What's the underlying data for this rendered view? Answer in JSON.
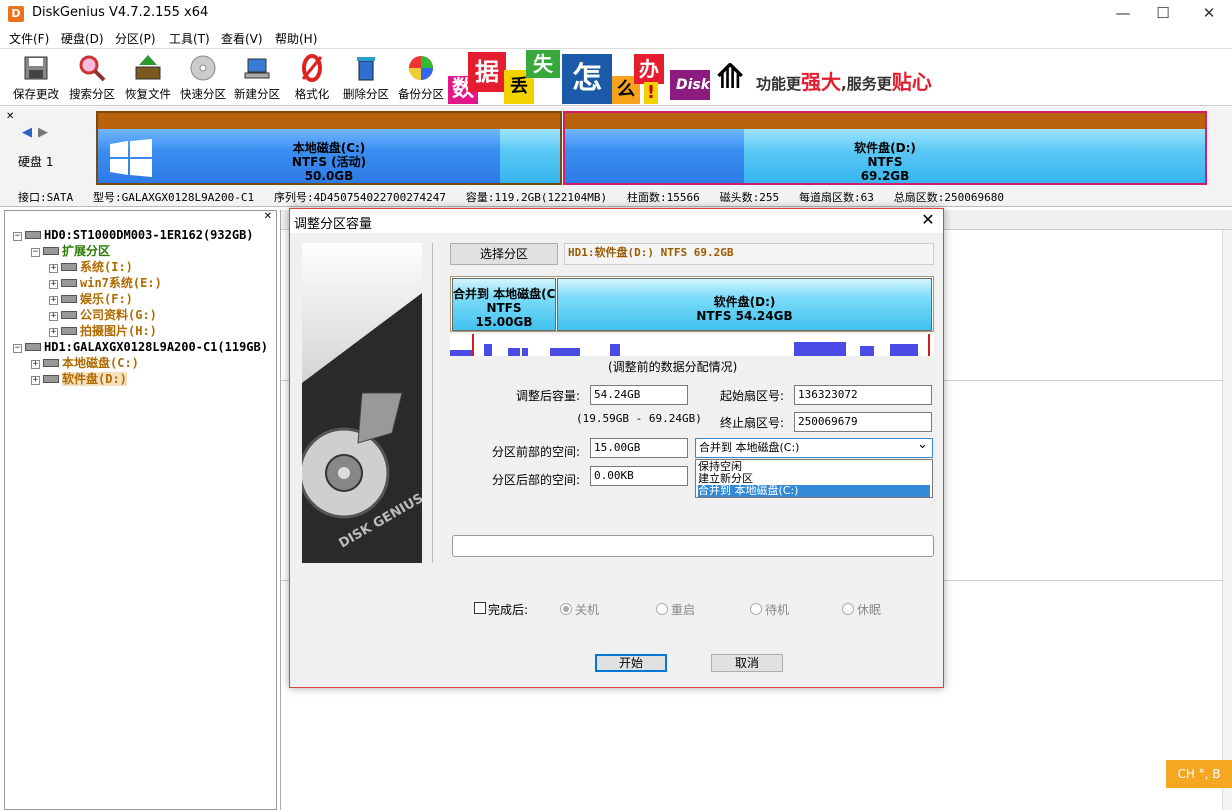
{
  "window": {
    "title": "DiskGenius V4.7.2.155 x64",
    "app_icon_letter": "D",
    "minimize": "—",
    "maximize": "☐",
    "close": "✕"
  },
  "menu": [
    "文件(F)",
    "硬盘(D)",
    "分区(P)",
    "工具(T)",
    "查看(V)",
    "帮助(H)"
  ],
  "toolbar": [
    "保存更改",
    "搜索分区",
    "恢复文件",
    "快速分区",
    "新建分区",
    "格式化",
    "删除分区",
    "备份分区"
  ],
  "ad": {
    "chars": [
      "数",
      "据",
      "丢",
      "失",
      "怎",
      "么",
      "办",
      "!"
    ],
    "brand": "Disk",
    "slogan_1": "功能更",
    "slogan_2": "强大",
    "slogan_3": ",服务更",
    "slogan_4": "贴心"
  },
  "disk": {
    "label": "硬盘 1",
    "nav_prev": "◀",
    "nav_next": "▶",
    "partitions": [
      {
        "name": "本地磁盘(C:)",
        "fs": "NTFS (活动)",
        "size": "50.0GB",
        "used_fraction": 0.87
      },
      {
        "name": "软件盘(D:)",
        "fs": "NTFS",
        "size": "69.2GB",
        "used_fraction": 0.28
      }
    ],
    "info": [
      "接口:SATA",
      "型号:GALAXGX0128L9A200-C1",
      "序列号:4D450754022700274247",
      "容量:119.2GB(122104MB)",
      "柱面数:15566",
      "磁头数:255",
      "每道扇区数:63",
      "总扇区数:250069680"
    ]
  },
  "tree": [
    {
      "text": "HD0:ST1000DM003-1ER162(932GB)",
      "level": 0,
      "color": "black",
      "exp": "⊟"
    },
    {
      "text": "扩展分区",
      "level": 1,
      "color": "green",
      "exp": "⊟"
    },
    {
      "text": "系统(I:)",
      "level": 2,
      "color": "orange",
      "exp": "⊞"
    },
    {
      "text": "win7系统(E:)",
      "level": 2,
      "color": "orange",
      "exp": "⊞"
    },
    {
      "text": "娱乐(F:)",
      "level": 2,
      "color": "orange",
      "exp": "⊞"
    },
    {
      "text": "公司资料(G:)",
      "level": 2,
      "color": "orange",
      "exp": "⊞"
    },
    {
      "text": "拍摄图片(H:)",
      "level": 2,
      "color": "orange",
      "exp": "⊞"
    },
    {
      "text": "HD1:GALAXGX0128L9A200-C1(119GB)",
      "level": 0,
      "color": "black",
      "exp": "⊟"
    },
    {
      "text": "本地磁盘(C:)",
      "level": 1,
      "color": "orange",
      "exp": "⊞"
    },
    {
      "text": "软件盘(D:)",
      "level": 1,
      "color": "orange",
      "exp": "⊞",
      "selected": true
    }
  ],
  "tree_close": "✕",
  "dialog": {
    "title": "调整分区容量",
    "close": "✕",
    "image_text": "DISK GENIUS",
    "select_btn": "选择分区",
    "selected_partition": "HD1:软件盘(D:) NTFS 69.2GB",
    "mini_parts": [
      {
        "name": "合并到 本地磁盘(C:)",
        "fs": "NTFS",
        "size": "15.00GB"
      },
      {
        "name": "软件盘(D:)",
        "fs": "NTFS",
        "size": "54.24GB"
      }
    ],
    "dist_caption": "(调整前的数据分配情况)",
    "size_after_label": "调整后容量:",
    "size_after": "54.24GB",
    "range": "(19.59GB - 69.24GB)",
    "start_label": "起始扇区号:",
    "start": "136323072",
    "end_label": "终止扇区号:",
    "end": "250069679",
    "before_label": "分区前部的空间:",
    "before": "15.00GB",
    "after_label": "分区后部的空间:",
    "after": "0.00KB",
    "combo_value": "合并到 本地磁盘(C:)",
    "combo_arrow": "⌄",
    "dropdown": [
      "保持空闲",
      "建立新分区",
      "合并到 本地磁盘(C:)"
    ],
    "finish_label": "完成后:",
    "radios": [
      "关机",
      "重启",
      "待机",
      "休眠"
    ],
    "start_btn": "开始",
    "cancel_btn": "取消"
  },
  "ime": "CH °, B"
}
